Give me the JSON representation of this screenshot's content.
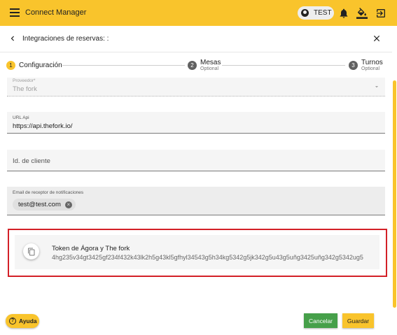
{
  "header": {
    "title": "Connect Manager",
    "user_name": "TEST",
    "icons": [
      "menu-icon",
      "account-circle-icon",
      "bell-icon",
      "format-color-fill-icon",
      "logout-icon"
    ]
  },
  "dialog": {
    "title": "Integraciones de reservas: :",
    "icons": [
      "arrow-back-icon",
      "close-icon"
    ]
  },
  "stepper": {
    "steps": [
      {
        "number": "1",
        "label": "Configuración",
        "sublabel": ""
      },
      {
        "number": "2",
        "label": "Mesas",
        "sublabel": "Optional"
      },
      {
        "number": "3",
        "label": "Turnos",
        "sublabel": "Optional"
      }
    ],
    "active_color": "#f9c42c",
    "inactive_color": "#616161"
  },
  "form": {
    "provider": {
      "label": "Proveedor*",
      "value": "The fork"
    },
    "url_api": {
      "label": "URL Api",
      "value": "https://api.thefork.io/"
    },
    "client_id": {
      "placeholder": "Id. de cliente"
    },
    "notification_email": {
      "label": "Email de receptor de notificaciones",
      "chips": [
        "test@test.com"
      ]
    }
  },
  "token": {
    "title": "Token de Ágora y The fork",
    "value": "4hg235v34gt3425gf234f432k43lk2h5g43kl5gfhyl34543g5h34kg5342g5jk342g5u43g5uñg3425uñg342g5342ug5",
    "icon": "copy-icon"
  },
  "footer": {
    "help_label": "Ayuda",
    "cancel_label": "Cancelar",
    "save_label": "Guardar"
  },
  "colors": {
    "brand_yellow": "#f9c42c",
    "cancel_green": "#46a04a",
    "highlight_red": "#d32027"
  }
}
